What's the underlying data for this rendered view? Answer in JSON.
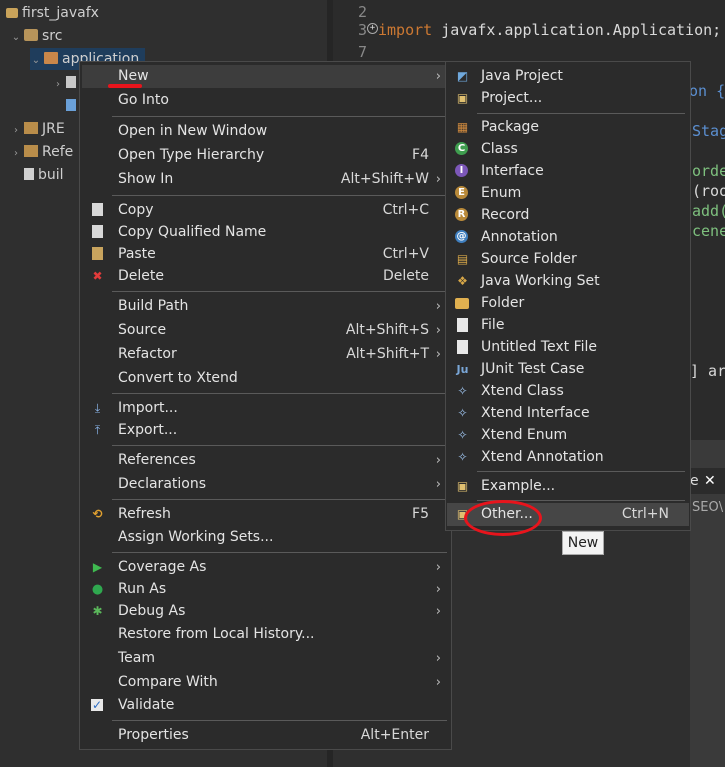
{
  "explorer": {
    "project": "first_javafx",
    "src": "src",
    "package": "application",
    "jre": "JRE",
    "refs": "Refe",
    "build": "buil"
  },
  "editor": {
    "line_numbers": [
      "2",
      "3",
      "7"
    ],
    "import_kw": "import",
    "import_text": " javafx.application.Application;",
    "fragments": [
      "on {",
      "Stag",
      "orde",
      "(roo",
      "add(",
      "cene",
      "] ar",
      "e",
      "SEO\\"
    ]
  },
  "context_menu": {
    "items": [
      {
        "label": "New",
        "shortcut": "",
        "submenu": true
      },
      {
        "label": "Go Into",
        "shortcut": ""
      },
      {
        "label": "Open in New Window",
        "shortcut": ""
      },
      {
        "label": "Open Type Hierarchy",
        "shortcut": "F4"
      },
      {
        "label": "Show In",
        "shortcut": "Alt+Shift+W",
        "submenu": true
      },
      {
        "label": "Copy",
        "shortcut": "Ctrl+C"
      },
      {
        "label": "Copy Qualified Name",
        "shortcut": ""
      },
      {
        "label": "Paste",
        "shortcut": "Ctrl+V"
      },
      {
        "label": "Delete",
        "shortcut": "Delete"
      },
      {
        "label": "Build Path",
        "shortcut": "",
        "submenu": true
      },
      {
        "label": "Source",
        "shortcut": "Alt+Shift+S",
        "submenu": true
      },
      {
        "label": "Refactor",
        "shortcut": "Alt+Shift+T",
        "submenu": true
      },
      {
        "label": "Convert to Xtend",
        "shortcut": ""
      },
      {
        "label": "Import...",
        "shortcut": ""
      },
      {
        "label": "Export...",
        "shortcut": ""
      },
      {
        "label": "References",
        "shortcut": "",
        "submenu": true
      },
      {
        "label": "Declarations",
        "shortcut": "",
        "submenu": true
      },
      {
        "label": "Refresh",
        "shortcut": "F5"
      },
      {
        "label": "Assign Working Sets...",
        "shortcut": ""
      },
      {
        "label": "Coverage As",
        "shortcut": "",
        "submenu": true
      },
      {
        "label": "Run As",
        "shortcut": "",
        "submenu": true
      },
      {
        "label": "Debug As",
        "shortcut": "",
        "submenu": true
      },
      {
        "label": "Restore from Local History...",
        "shortcut": ""
      },
      {
        "label": "Team",
        "shortcut": "",
        "submenu": true
      },
      {
        "label": "Compare With",
        "shortcut": "",
        "submenu": true
      },
      {
        "label": "Validate",
        "shortcut": ""
      },
      {
        "label": "Properties",
        "shortcut": "Alt+Enter"
      }
    ]
  },
  "new_submenu": {
    "items": [
      {
        "label": "Java Project"
      },
      {
        "label": "Project..."
      },
      {
        "label": "Package"
      },
      {
        "label": "Class"
      },
      {
        "label": "Interface"
      },
      {
        "label": "Enum"
      },
      {
        "label": "Record"
      },
      {
        "label": "Annotation"
      },
      {
        "label": "Source Folder"
      },
      {
        "label": "Java Working Set"
      },
      {
        "label": "Folder"
      },
      {
        "label": "File"
      },
      {
        "label": "Untitled Text File"
      },
      {
        "label": "JUnit Test Case"
      },
      {
        "label": "Xtend Class"
      },
      {
        "label": "Xtend Interface"
      },
      {
        "label": "Xtend Enum"
      },
      {
        "label": "Xtend Annotation"
      },
      {
        "label": "Example..."
      },
      {
        "label": "Other...",
        "shortcut": "Ctrl+N"
      }
    ]
  },
  "tooltip": "New",
  "colors": {
    "annotation_red": "#e8141c",
    "menu_bg": "#2b2b2b",
    "highlight": "#464646"
  }
}
